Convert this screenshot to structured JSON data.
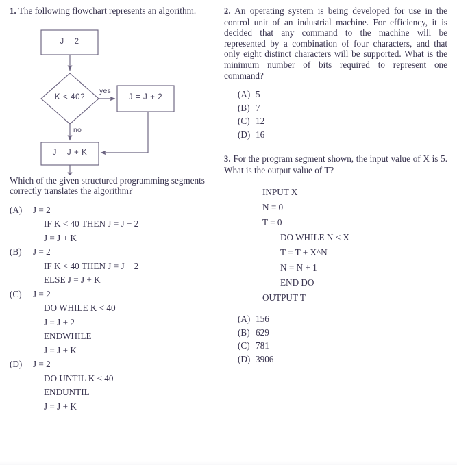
{
  "page": {
    "background_color": "#ffffff",
    "ink_color": "#3a3550"
  },
  "question1": {
    "number": "1.",
    "stem": "The following flowchart represents an algorithm.",
    "flowchart": {
      "nodes": [
        {
          "id": "start",
          "shape": "rectangle",
          "text": "J = 2"
        },
        {
          "id": "decision",
          "shape": "diamond",
          "text": "K < 40?"
        },
        {
          "id": "then",
          "shape": "rectangle",
          "text": "J = J + 2"
        },
        {
          "id": "after",
          "shape": "rectangle",
          "text": "J = J + K"
        }
      ],
      "edge_labels": {
        "yes": "yes",
        "no": "no"
      }
    },
    "prompt": "Which of the given structured programming segments correctly translates the algorithm?",
    "options": [
      {
        "tag": "(A)",
        "lines": [
          "J = 2",
          "IF K < 40 THEN J = J + 2",
          "J = J + K"
        ]
      },
      {
        "tag": "(B)",
        "lines": [
          "J = 2",
          "IF K < 40 THEN J = J + 2",
          "ELSE J = J + K"
        ]
      },
      {
        "tag": "(C)",
        "lines": [
          "J = 2",
          "DO WHILE K < 40",
          "J = J + 2",
          "ENDWHILE",
          "J = J + K"
        ]
      },
      {
        "tag": "(D)",
        "lines": [
          "J = 2",
          "DO UNTIL K < 40",
          "ENDUNTIL",
          "J = J + K"
        ]
      }
    ]
  },
  "question2": {
    "number": "2.",
    "stem": "An operating system is being developed for use in the control unit of an industrial machine. For efficiency, it is decided that any command to the machine will be represented by a combination of four characters, and that only eight distinct characters will be supported. What is the minimum number of bits required to represent one command?",
    "choices": [
      {
        "tag": "(A)",
        "text": "5"
      },
      {
        "tag": "(B)",
        "text": "7"
      },
      {
        "tag": "(C)",
        "text": "12"
      },
      {
        "tag": "(D)",
        "text": "16"
      }
    ]
  },
  "question3": {
    "number": "3.",
    "stem": "For the program segment shown, the input value of X is 5. What is the output value of T?",
    "program": [
      {
        "text": "INPUT X",
        "indent": 0
      },
      {
        "text": "N = 0",
        "indent": 0
      },
      {
        "text": "T = 0",
        "indent": 0
      },
      {
        "text": "DO WHILE N < X",
        "indent": 1
      },
      {
        "text": "T = T + X^N",
        "indent": 1
      },
      {
        "text": "N = N + 1",
        "indent": 1
      },
      {
        "text": "END DO",
        "indent": 1
      },
      {
        "text": "OUTPUT T",
        "indent": 0
      }
    ],
    "choices": [
      {
        "tag": "(A)",
        "text": "156"
      },
      {
        "tag": "(B)",
        "text": "629"
      },
      {
        "tag": "(C)",
        "text": "781"
      },
      {
        "tag": "(D)",
        "text": "3906"
      }
    ]
  }
}
